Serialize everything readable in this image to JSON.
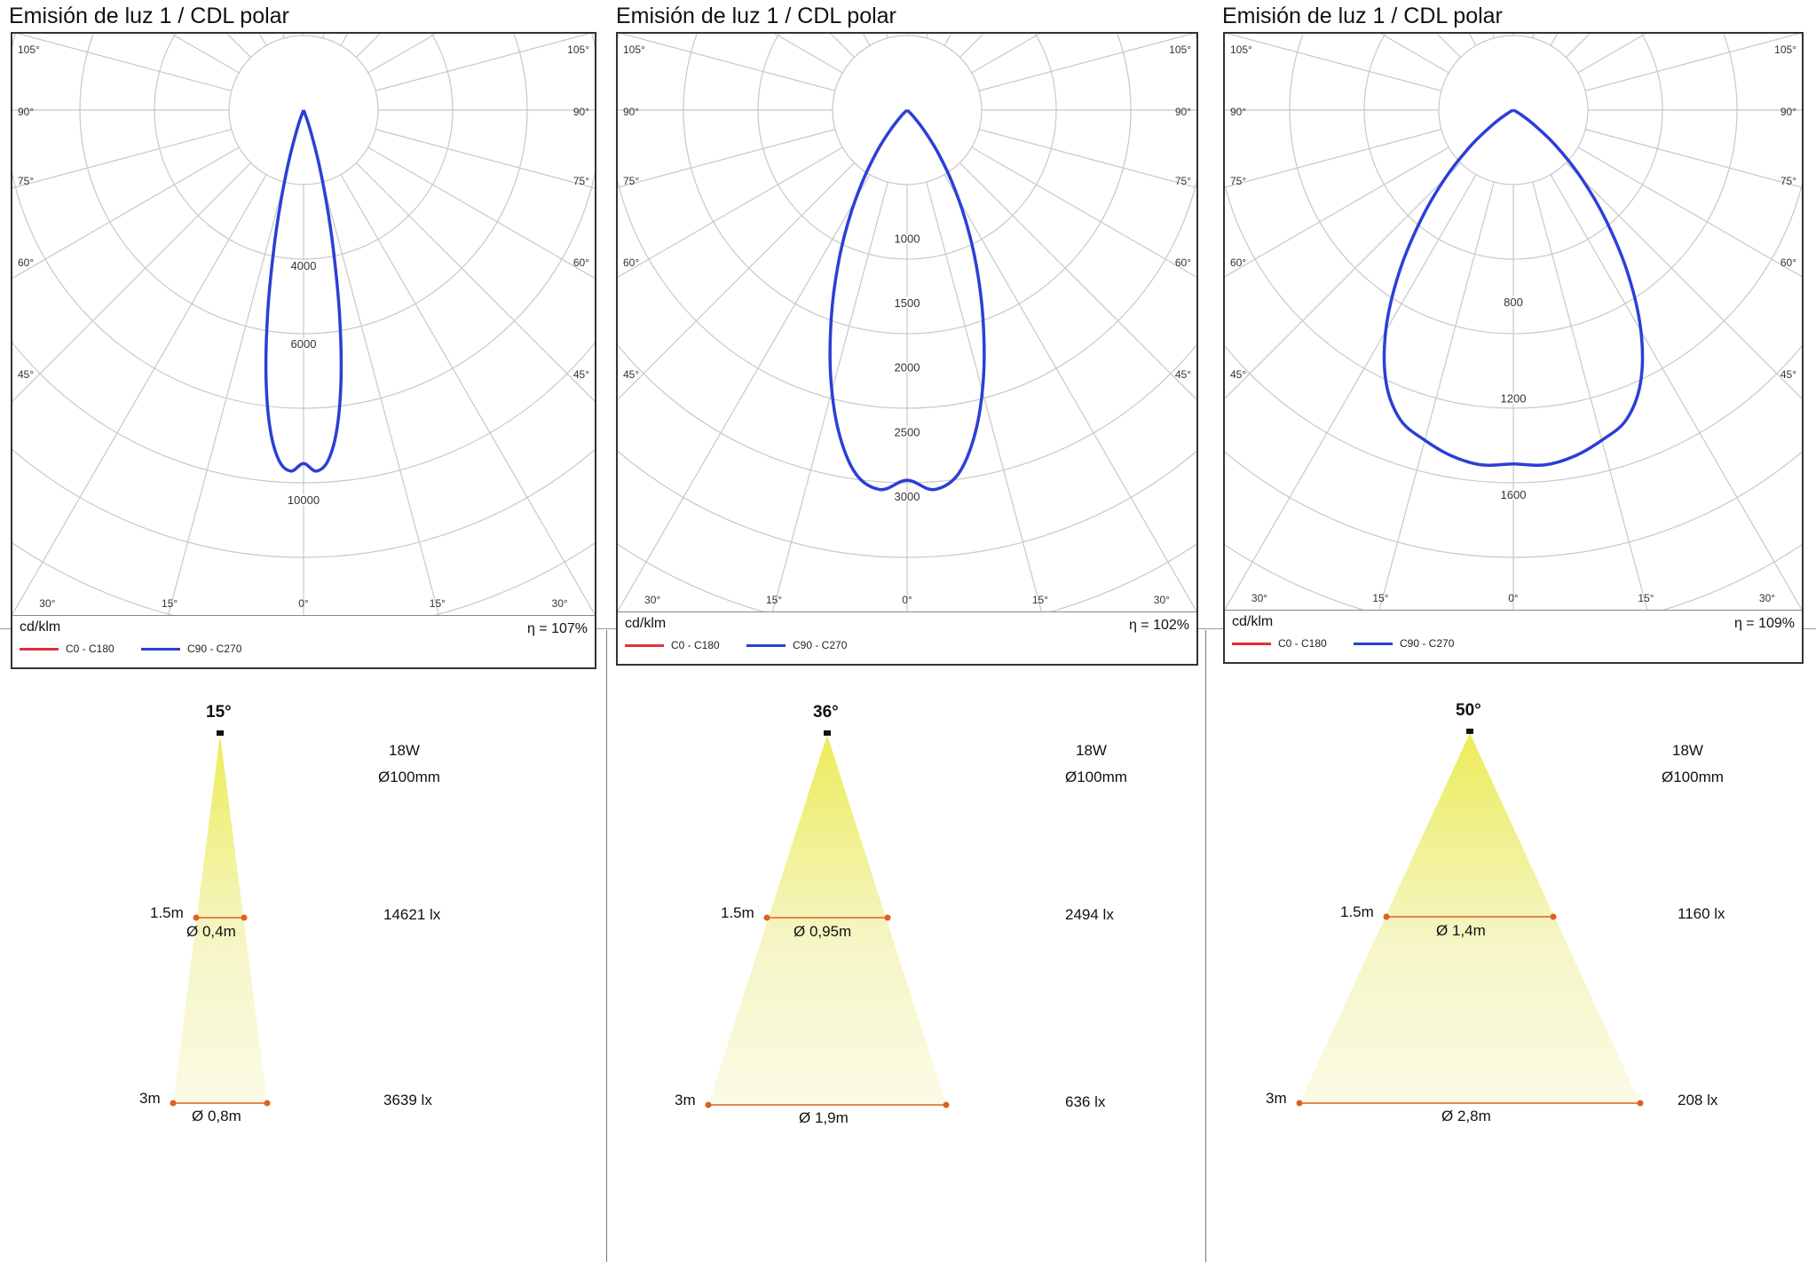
{
  "panels": [
    {
      "title": "Emisión de luz 1 / CDL polar",
      "unit": "cd/klm",
      "eta": "η = 107%",
      "legend": [
        "C0 - C180",
        "C90 - C270"
      ],
      "beam_angle": "15°",
      "power": "18W",
      "diameter": "Ø100mm",
      "d1_label": "1.5m",
      "d1_spot": "Ø 0,4m",
      "d1_lux": "14621 lx",
      "d2_label": "3m",
      "d2_spot": "Ø 0,8m",
      "d2_lux": "3639 lx"
    },
    {
      "title": "Emisión de luz 1 / CDL polar",
      "unit": "cd/klm",
      "eta": "η = 102%",
      "legend": [
        "C0 - C180",
        "C90 - C270"
      ],
      "beam_angle": "36°",
      "power": "18W",
      "diameter": "Ø100mm",
      "d1_label": "1.5m",
      "d1_spot": "Ø 0,95m",
      "d1_lux": "2494 lx",
      "d2_label": "3m",
      "d2_spot": "Ø 1,9m",
      "d2_lux": "636 lx"
    },
    {
      "title": "Emisión de luz 1 / CDL polar",
      "unit": "cd/klm",
      "eta": "η = 109%",
      "legend": [
        "C0 - C180",
        "C90 - C270"
      ],
      "beam_angle": "50°",
      "power": "18W",
      "diameter": "Ø100mm",
      "d1_label": "1.5m",
      "d1_spot": "Ø 1,4m",
      "d1_lux": "1160 lx",
      "d2_label": "3m",
      "d2_spot": "Ø 2,8m",
      "d2_lux": "208 lx"
    }
  ],
  "colors": {
    "c0_c180": "#e0303c",
    "c90_c270": "#2b3fd6",
    "grid": "#c8c8c8",
    "beam_top": "#ecec5a",
    "beam_bottom": "#fbfbe6",
    "marker": "#e06020"
  },
  "chart_data": [
    {
      "type": "polar",
      "title": "Emisión de luz 1 / CDL polar",
      "unit": "cd/klm",
      "angle_labels": [
        "105°",
        "90°",
        "75°",
        "60°",
        "45°",
        "30°",
        "15°",
        "0°"
      ],
      "radial_tick_labels": [
        "4000",
        "6000",
        "10000"
      ],
      "radial_ticks": [
        4000,
        6000,
        10000
      ],
      "series": [
        {
          "name": "C90 - C270",
          "angles_deg": [
            0,
            2,
            4,
            6,
            8,
            10,
            12,
            14,
            16,
            18,
            20,
            22
          ],
          "values": [
            9050,
            9250,
            9000,
            8200,
            6900,
            5300,
            3700,
            2400,
            1400,
            700,
            300,
            0
          ]
        }
      ],
      "efficiency": "η = 107%"
    },
    {
      "type": "polar",
      "title": "Emisión de luz 1 / CDL polar",
      "unit": "cd/klm",
      "angle_labels": [
        "105°",
        "90°",
        "75°",
        "60°",
        "45°",
        "30°",
        "15°",
        "0°"
      ],
      "radial_tick_labels": [
        "1000",
        "1500",
        "2000",
        "2500",
        "3000"
      ],
      "radial_ticks": [
        1000,
        1500,
        2000,
        2500,
        3000
      ],
      "series": [
        {
          "name": "C90 - C270",
          "angles_deg": [
            0,
            4,
            8,
            12,
            16,
            20,
            24,
            28,
            32,
            36,
            40,
            45,
            50
          ],
          "values": [
            2870,
            2950,
            2850,
            2550,
            2150,
            1720,
            1320,
            960,
            650,
            400,
            200,
            60,
            0
          ]
        }
      ],
      "efficiency": "η = 102%"
    },
    {
      "type": "polar",
      "title": "Emisión de luz 1 / CDL polar",
      "unit": "cd/klm",
      "angle_labels": [
        "105°",
        "90°",
        "75°",
        "60°",
        "45°",
        "30°",
        "15°",
        "0°"
      ],
      "radial_tick_labels": [
        "800",
        "1200",
        "1600"
      ],
      "radial_ticks": [
        800,
        1200,
        1600
      ],
      "series": [
        {
          "name": "C90 - C270",
          "angles_deg": [
            0,
            5,
            10,
            15,
            20,
            25,
            30,
            35,
            40,
            45,
            50,
            55,
            60,
            65
          ],
          "values": [
            1470,
            1480,
            1460,
            1420,
            1370,
            1250,
            1060,
            830,
            600,
            400,
            230,
            100,
            30,
            0
          ]
        }
      ],
      "efficiency": "η = 109%"
    }
  ]
}
